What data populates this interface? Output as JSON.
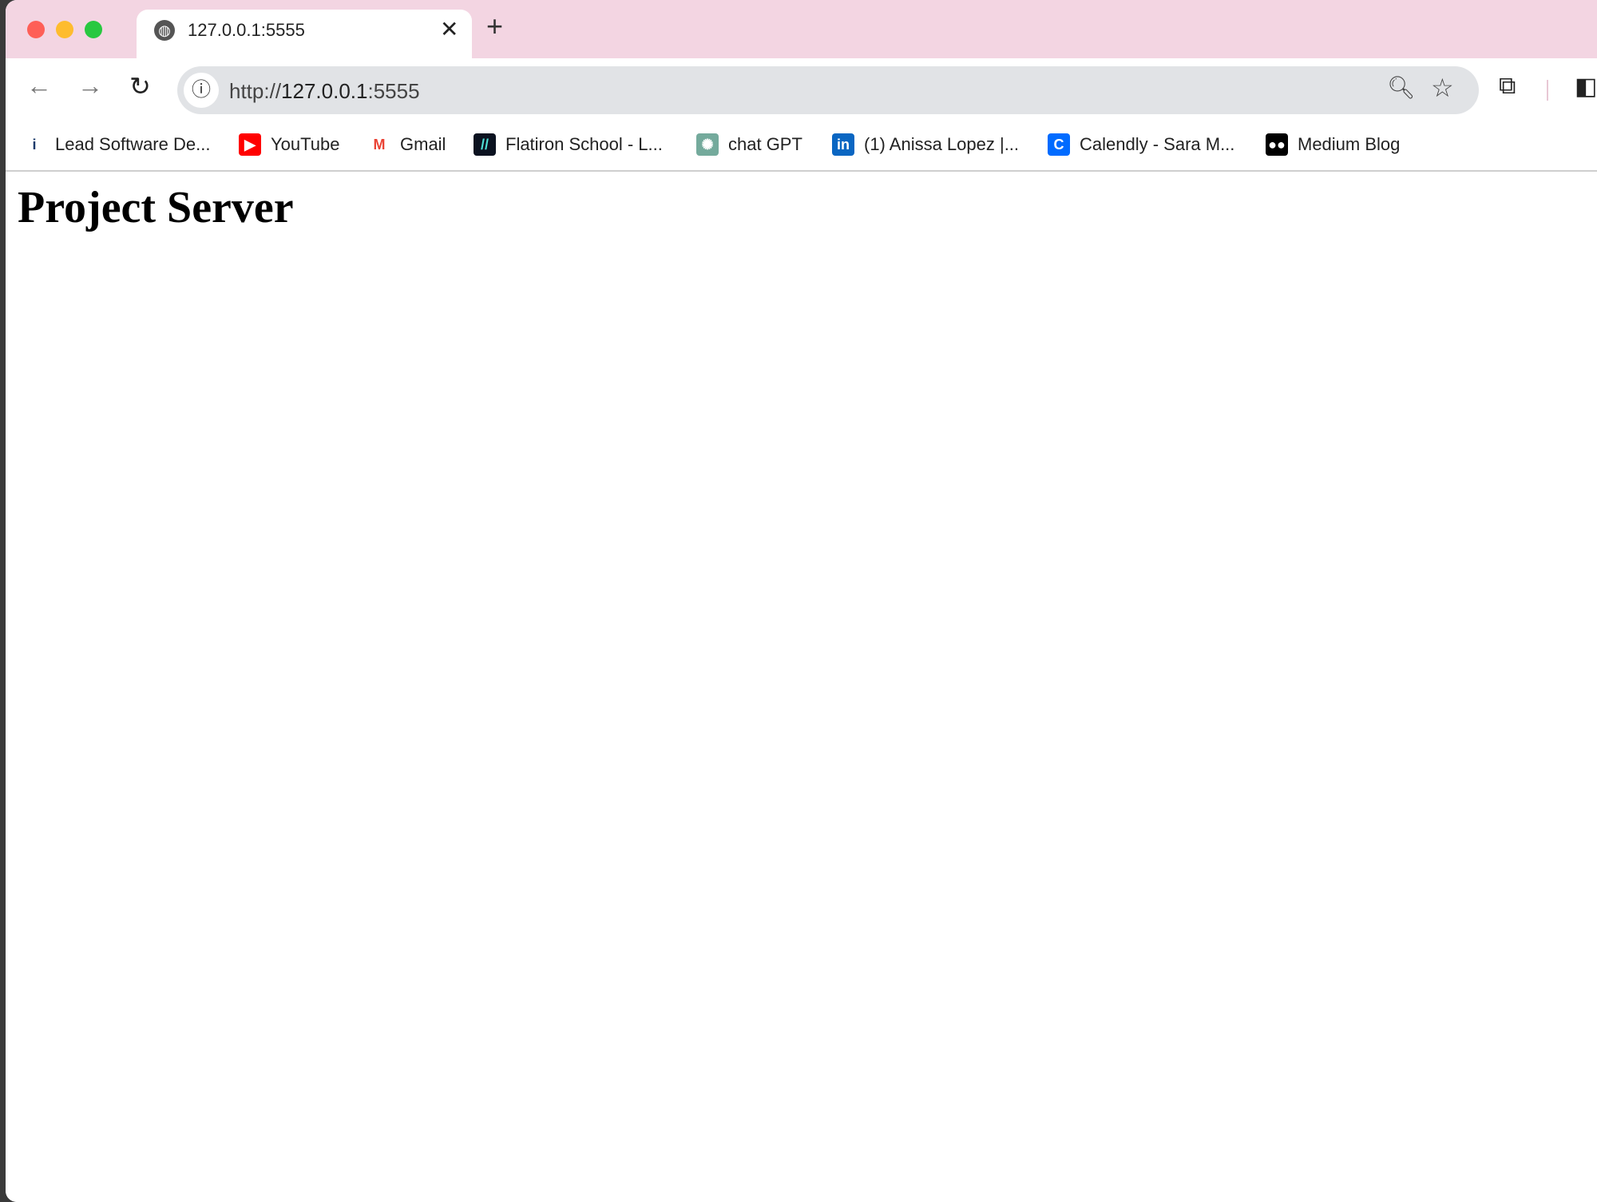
{
  "tab": {
    "title": "127.0.0.1:5555",
    "close": "✕",
    "new_tab": "+"
  },
  "toolbar": {
    "back": "←",
    "forward": "→",
    "reload": "↻",
    "url_prefix": "http://",
    "url_host": "127.0.0.1",
    "url_port": ":5555"
  },
  "bookmarks": [
    {
      "label": "Lead Software De...",
      "icon": "i",
      "color": "#1b3a6b"
    },
    {
      "label": "YouTube",
      "icon": "▶",
      "color": "#ff0000"
    },
    {
      "label": "Gmail",
      "icon": "M",
      "color": "#ea4335"
    },
    {
      "label": "Flatiron School - L...",
      "icon": "//",
      "color": "#0b1220"
    },
    {
      "label": "chat GPT",
      "icon": "✺",
      "color": "#74aa9c"
    },
    {
      "label": "(1) Anissa Lopez |...",
      "icon": "in",
      "color": "#0a66c2"
    },
    {
      "label": "Calendly - Sara M...",
      "icon": "C",
      "color": "#006bff"
    },
    {
      "label": "Medium Blog",
      "icon": "●●",
      "color": "#000000"
    }
  ],
  "page": {
    "heading": "Project Server"
  },
  "colors": {
    "tabbar": "#f3d5e2",
    "omnibox": "#e1e3e6"
  }
}
